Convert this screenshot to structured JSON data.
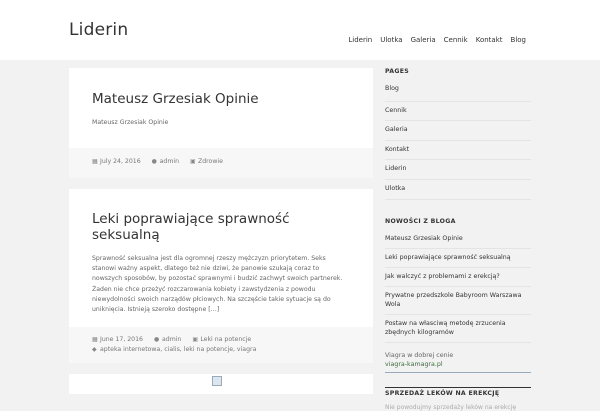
{
  "site": {
    "title": "Liderin"
  },
  "nav": [
    "Liderin",
    "Ulotka",
    "Galeria",
    "Cennik",
    "Kontakt",
    "Blog"
  ],
  "posts": [
    {
      "title": "Mateusz Grzesiak Opinie",
      "excerpt": "Mateusz Grzesiak Opinie",
      "date": "July 24, 2016",
      "author": "admin",
      "category": "Zdrowie"
    },
    {
      "title": "Leki poprawiające sprawność seksualną",
      "excerpt": "Sprawność seksualna jest dla ogromnej rzeszy mężczyzn priorytetem. Seks stanowi ważny aspekt, dlatego też nie dziwi, że panowie szukają coraz to nowszych sposobów, by pozostać sprawnymi i budzić zachwyt swoich partnerek. Żaden nie chce przeżyć rozczarowania kobiety i zawstydzenia z powodu niewydolności swoich narządów płciowych. Na szczęście takie sytuacje są do uniknięcia. Istnieją szeroko dostępne […]",
      "date": "June 17, 2016",
      "author": "admin",
      "category": "Leki na potencje",
      "tags": "apteka internetowa, cialis, leki na potencje, viagra"
    }
  ],
  "sidebar": {
    "pages_title": "PAGES",
    "pages": [
      "Blog",
      "Cennik",
      "Galeria",
      "Kontakt",
      "Liderin",
      "Ulotka"
    ],
    "news_title": "NOWOŚCI Z BLOGA",
    "news": [
      "Mateusz Grzesiak Opinie",
      "Leki poprawiające sprawność seksualną",
      "Jak walczyć z problemami z erekcją?",
      "Prywatne przedszkole Babyroom Warszawa Wola",
      "Postaw na własciwą metodę zrzucenia zbędnych kilogramów"
    ],
    "ad_text": "Viagra w dobrej cenie",
    "ad_link": "viagra-kamagra.pl",
    "sale_title": "SPRZEDAŻ LEKÓW NA EREKCJĘ",
    "sale_text": "Nie powodujmy sprzedaży leków na erekcję"
  },
  "colors": {
    "accent": "#2a7a2a",
    "background": "#f2f2f2",
    "card": "#ffffff"
  }
}
